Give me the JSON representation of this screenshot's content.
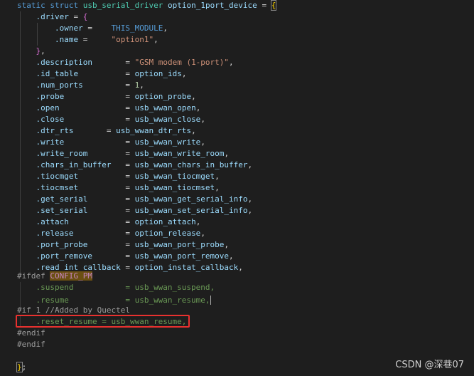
{
  "code_lines": [
    "static struct usb_serial_driver option_1port_device = {",
    "    .driver = {",
    "        .owner =    THIS_MODULE,",
    "        .name =     \"option1\",",
    "    },",
    "    .description       = \"GSM modem (1-port)\",",
    "    .id_table          = option_ids,",
    "    .num_ports         = 1,",
    "    .probe             = option_probe,",
    "    .open              = usb_wwan_open,",
    "    .close             = usb_wwan_close,",
    "    .dtr_rts       = usb_wwan_dtr_rts,",
    "    .write             = usb_wwan_write,",
    "    .write_room        = usb_wwan_write_room,",
    "    .chars_in_buffer   = usb_wwan_chars_in_buffer,",
    "    .tiocmget          = usb_wwan_tiocmget,",
    "    .tiocmset          = usb_wwan_tiocmset,",
    "    .get_serial        = usb_wwan_get_serial_info,",
    "    .set_serial        = usb_wwan_set_serial_info,",
    "    .attach            = option_attach,",
    "    .release           = option_release,",
    "    .port_probe        = usb_wwan_port_probe,",
    "    .port_remove       = usb_wwan_port_remove,",
    "    .read_int_callback = option_instat_callback,",
    "#ifdef CONFIG_PM",
    "    .suspend           = usb_wwan_suspend,",
    "    .resume            = usb_wwan_resume,",
    "#if 1 //Added by Quectel",
    "    .reset_resume = usb_wwan_resume,",
    "#endif",
    "#endif",
    "",
    "};"
  ],
  "watermark": "CSDN @深巷07",
  "colors": {
    "background": "#1e1e1e",
    "keyword": "#569cd6",
    "type": "#4ec9b0",
    "field": "#9cdcfe",
    "string": "#ce9178",
    "number": "#b5cea8",
    "preprocessor": "#9b9b9b",
    "inactive_code": "#6a9955",
    "highlight_box": "#e8312f"
  }
}
